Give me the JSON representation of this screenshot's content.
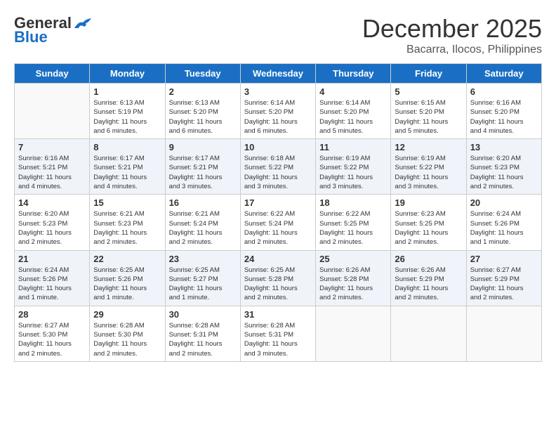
{
  "logo": {
    "general": "General",
    "blue": "Blue"
  },
  "title": "December 2025",
  "subtitle": "Bacarra, Ilocos, Philippines",
  "days_of_week": [
    "Sunday",
    "Monday",
    "Tuesday",
    "Wednesday",
    "Thursday",
    "Friday",
    "Saturday"
  ],
  "weeks": [
    [
      {
        "day": "",
        "info": ""
      },
      {
        "day": "1",
        "info": "Sunrise: 6:13 AM\nSunset: 5:19 PM\nDaylight: 11 hours\nand 6 minutes."
      },
      {
        "day": "2",
        "info": "Sunrise: 6:13 AM\nSunset: 5:20 PM\nDaylight: 11 hours\nand 6 minutes."
      },
      {
        "day": "3",
        "info": "Sunrise: 6:14 AM\nSunset: 5:20 PM\nDaylight: 11 hours\nand 6 minutes."
      },
      {
        "day": "4",
        "info": "Sunrise: 6:14 AM\nSunset: 5:20 PM\nDaylight: 11 hours\nand 5 minutes."
      },
      {
        "day": "5",
        "info": "Sunrise: 6:15 AM\nSunset: 5:20 PM\nDaylight: 11 hours\nand 5 minutes."
      },
      {
        "day": "6",
        "info": "Sunrise: 6:16 AM\nSunset: 5:20 PM\nDaylight: 11 hours\nand 4 minutes."
      }
    ],
    [
      {
        "day": "7",
        "info": "Sunrise: 6:16 AM\nSunset: 5:21 PM\nDaylight: 11 hours\nand 4 minutes."
      },
      {
        "day": "8",
        "info": "Sunrise: 6:17 AM\nSunset: 5:21 PM\nDaylight: 11 hours\nand 4 minutes."
      },
      {
        "day": "9",
        "info": "Sunrise: 6:17 AM\nSunset: 5:21 PM\nDaylight: 11 hours\nand 3 minutes."
      },
      {
        "day": "10",
        "info": "Sunrise: 6:18 AM\nSunset: 5:22 PM\nDaylight: 11 hours\nand 3 minutes."
      },
      {
        "day": "11",
        "info": "Sunrise: 6:19 AM\nSunset: 5:22 PM\nDaylight: 11 hours\nand 3 minutes."
      },
      {
        "day": "12",
        "info": "Sunrise: 6:19 AM\nSunset: 5:22 PM\nDaylight: 11 hours\nand 3 minutes."
      },
      {
        "day": "13",
        "info": "Sunrise: 6:20 AM\nSunset: 5:23 PM\nDaylight: 11 hours\nand 2 minutes."
      }
    ],
    [
      {
        "day": "14",
        "info": "Sunrise: 6:20 AM\nSunset: 5:23 PM\nDaylight: 11 hours\nand 2 minutes."
      },
      {
        "day": "15",
        "info": "Sunrise: 6:21 AM\nSunset: 5:23 PM\nDaylight: 11 hours\nand 2 minutes."
      },
      {
        "day": "16",
        "info": "Sunrise: 6:21 AM\nSunset: 5:24 PM\nDaylight: 11 hours\nand 2 minutes."
      },
      {
        "day": "17",
        "info": "Sunrise: 6:22 AM\nSunset: 5:24 PM\nDaylight: 11 hours\nand 2 minutes."
      },
      {
        "day": "18",
        "info": "Sunrise: 6:22 AM\nSunset: 5:25 PM\nDaylight: 11 hours\nand 2 minutes."
      },
      {
        "day": "19",
        "info": "Sunrise: 6:23 AM\nSunset: 5:25 PM\nDaylight: 11 hours\nand 2 minutes."
      },
      {
        "day": "20",
        "info": "Sunrise: 6:24 AM\nSunset: 5:26 PM\nDaylight: 11 hours\nand 1 minute."
      }
    ],
    [
      {
        "day": "21",
        "info": "Sunrise: 6:24 AM\nSunset: 5:26 PM\nDaylight: 11 hours\nand 1 minute."
      },
      {
        "day": "22",
        "info": "Sunrise: 6:25 AM\nSunset: 5:26 PM\nDaylight: 11 hours\nand 1 minute."
      },
      {
        "day": "23",
        "info": "Sunrise: 6:25 AM\nSunset: 5:27 PM\nDaylight: 11 hours\nand 1 minute."
      },
      {
        "day": "24",
        "info": "Sunrise: 6:25 AM\nSunset: 5:28 PM\nDaylight: 11 hours\nand 2 minutes."
      },
      {
        "day": "25",
        "info": "Sunrise: 6:26 AM\nSunset: 5:28 PM\nDaylight: 11 hours\nand 2 minutes."
      },
      {
        "day": "26",
        "info": "Sunrise: 6:26 AM\nSunset: 5:29 PM\nDaylight: 11 hours\nand 2 minutes."
      },
      {
        "day": "27",
        "info": "Sunrise: 6:27 AM\nSunset: 5:29 PM\nDaylight: 11 hours\nand 2 minutes."
      }
    ],
    [
      {
        "day": "28",
        "info": "Sunrise: 6:27 AM\nSunset: 5:30 PM\nDaylight: 11 hours\nand 2 minutes."
      },
      {
        "day": "29",
        "info": "Sunrise: 6:28 AM\nSunset: 5:30 PM\nDaylight: 11 hours\nand 2 minutes."
      },
      {
        "day": "30",
        "info": "Sunrise: 6:28 AM\nSunset: 5:31 PM\nDaylight: 11 hours\nand 2 minutes."
      },
      {
        "day": "31",
        "info": "Sunrise: 6:28 AM\nSunset: 5:31 PM\nDaylight: 11 hours\nand 3 minutes."
      },
      {
        "day": "",
        "info": ""
      },
      {
        "day": "",
        "info": ""
      },
      {
        "day": "",
        "info": ""
      }
    ]
  ]
}
